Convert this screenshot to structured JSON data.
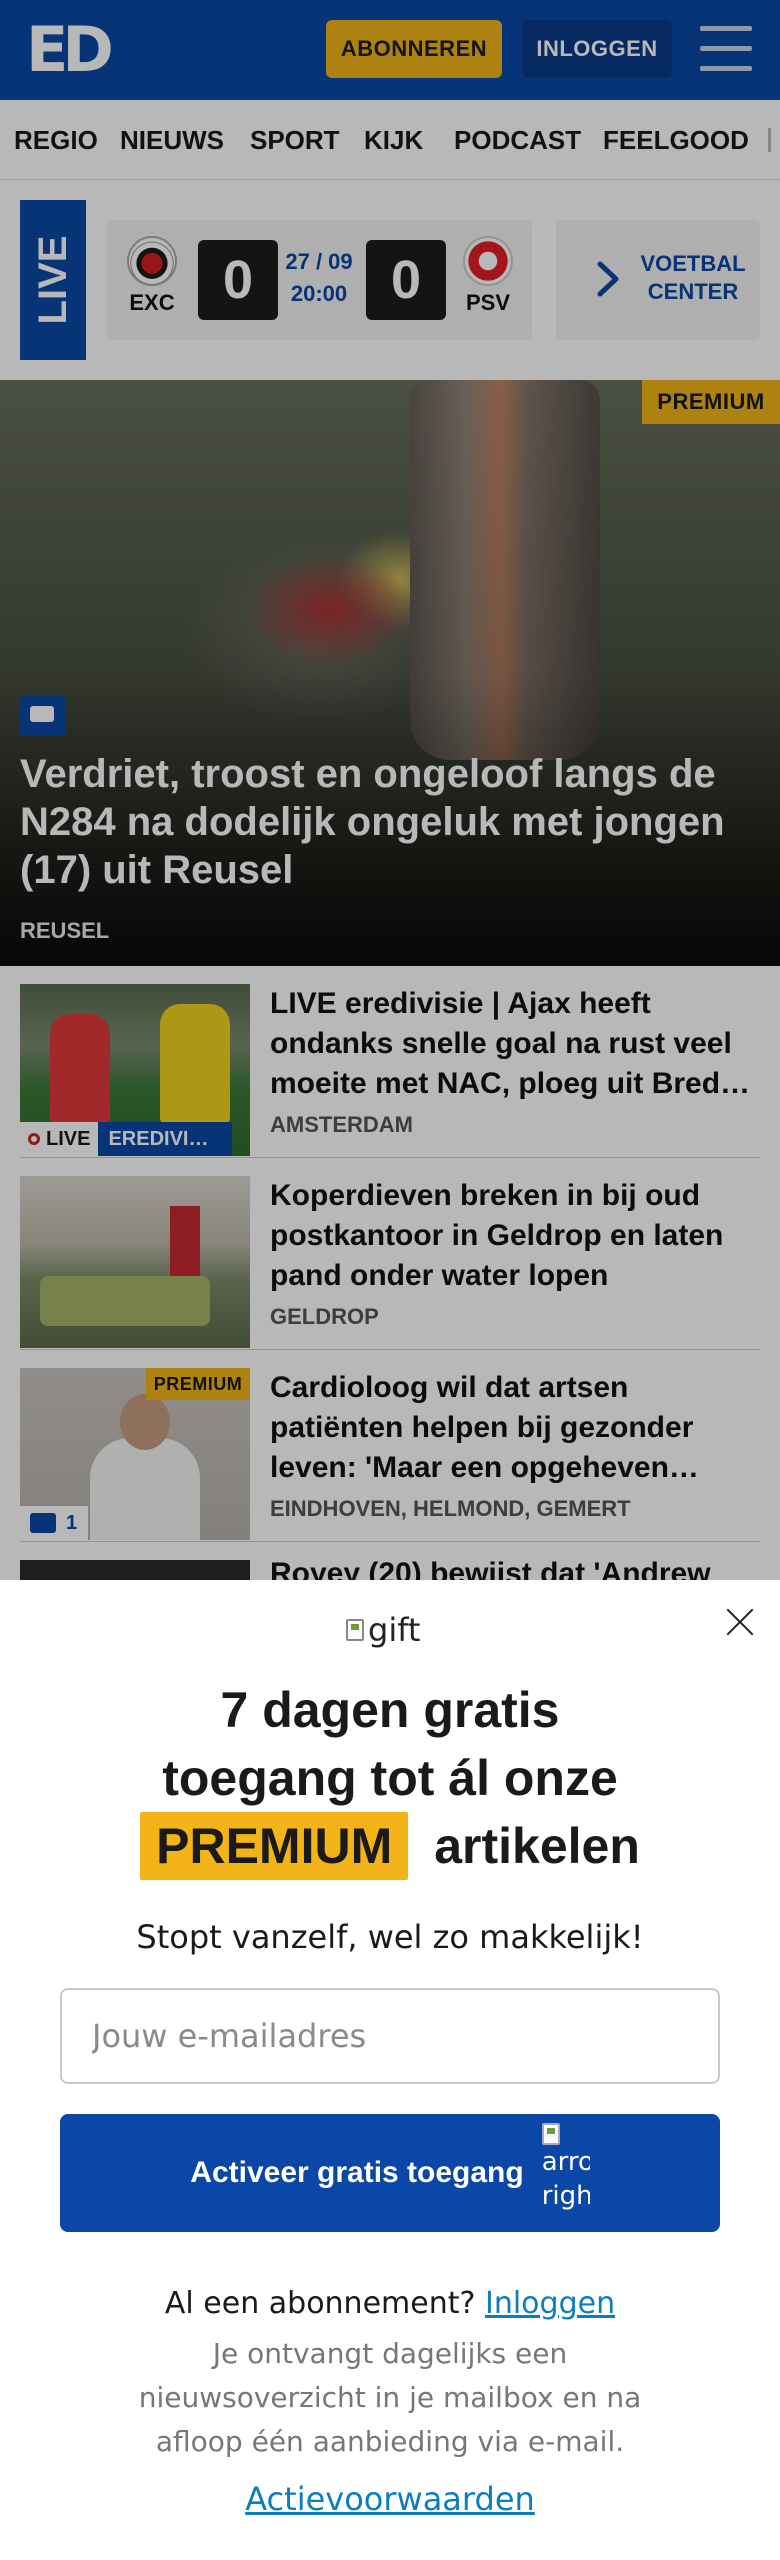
{
  "header": {
    "logo": "ED",
    "subscribe_label": "ABONNEREN",
    "login_label": "INLOGGEN",
    "colors": {
      "primary": "#0b47a6",
      "accent": "#f2b418"
    }
  },
  "nav": {
    "items": [
      "REGIO",
      "NIEUWS",
      "SPORT",
      "KIJK",
      "PODCAST",
      "FEELGOOD"
    ]
  },
  "live_match": {
    "live_label": "LIVE",
    "home_team": "EXC",
    "away_team": "PSV",
    "home_score": "0",
    "away_score": "0",
    "date": "27 / 09",
    "time": "20:00",
    "center_label": "VOETBAL CENTER"
  },
  "hero": {
    "badge": "PREMIUM",
    "title": "Verdriet, troost en ongeloof langs de N284 na dodelijk ongeluk met jongen (17) uit Reusel",
    "location": "REUSEL"
  },
  "articles": [
    {
      "title": "LIVE eredivisie | Ajax heeft ondanks snelle goal na rust veel moeite met NAC, ploeg uit Bred…",
      "location": "AMSTERDAM",
      "live_tag": "LIVE",
      "category_tag": "EREDIVI…"
    },
    {
      "title": "Koperdieven breken in bij oud postkantoor in Geldrop en laten pand onder water lopen",
      "location": "GELDROP"
    },
    {
      "title": "Cardioloog wil dat artsen patiënten helpen bij gezonder leven: 'Maar een opgeheven…",
      "location": "EINDHOVEN, HELMOND, GEMERT",
      "badge": "PREMIUM",
      "comments": "1"
    }
  ],
  "peek_article_title": "Royey (20) bewijst dat 'Andrew",
  "modal": {
    "gift_alt": "gift",
    "headline_line1": "7 dagen gratis",
    "headline_line2": "toegang tot ál onze",
    "headline_highlight": "PREMIUM",
    "headline_word": "artikelen",
    "subtitle": "Stopt vanzelf, wel zo makkelijk!",
    "email_placeholder": "Jouw e-mailadres",
    "email_value": "",
    "activate_label": "Activeer gratis toegang",
    "arrow_alt": "arrow-right",
    "arrow_alt_visible_1": "arro",
    "arrow_alt_visible_2": "righ",
    "already_text": "Al een abonnement?",
    "login_link": "Inloggen",
    "info_text": "Je ontvangt dagelijks een nieuwsoverzicht in je mailbox en na afloop één aanbieding via e-mail.",
    "terms_link": "Actievoorwaarden"
  }
}
